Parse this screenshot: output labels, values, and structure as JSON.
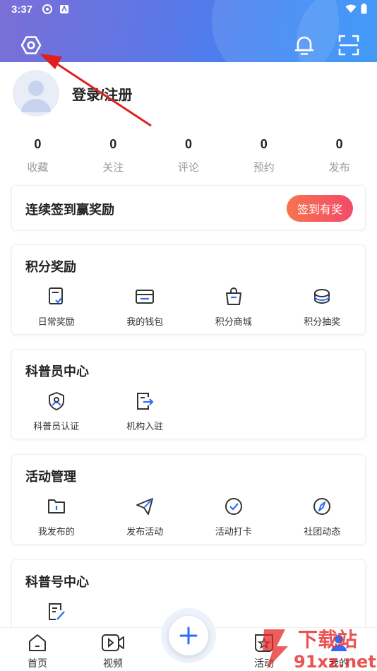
{
  "status_bar": {
    "time": "3:37"
  },
  "profile": {
    "login_label": "登录/注册"
  },
  "stats": [
    {
      "value": "0",
      "label": "收藏"
    },
    {
      "value": "0",
      "label": "关注"
    },
    {
      "value": "0",
      "label": "评论"
    },
    {
      "value": "0",
      "label": "预约"
    },
    {
      "value": "0",
      "label": "发布"
    }
  ],
  "signin_card": {
    "title": "连续签到赢奖励",
    "button_label": "签到有奖"
  },
  "points_card": {
    "title": "积分奖励",
    "items": [
      {
        "label": "日常奖励",
        "icon": "daily-reward-icon"
      },
      {
        "label": "我的钱包",
        "icon": "wallet-icon"
      },
      {
        "label": "积分商城",
        "icon": "shopping-bag-icon"
      },
      {
        "label": "积分抽奖",
        "icon": "coins-icon"
      }
    ]
  },
  "science_card": {
    "title": "科普员中心",
    "items": [
      {
        "label": "科普员认证",
        "icon": "shield-user-icon"
      },
      {
        "label": "机构入驻",
        "icon": "door-enter-icon"
      }
    ]
  },
  "activity_card": {
    "title": "活动管理",
    "items": [
      {
        "label": "我发布的",
        "icon": "folder-icon"
      },
      {
        "label": "发布活动",
        "icon": "paper-plane-icon"
      },
      {
        "label": "活动打卡",
        "icon": "check-circle-icon"
      },
      {
        "label": "社团动态",
        "icon": "compass-icon"
      }
    ]
  },
  "account_card": {
    "title": "科普号中心",
    "items": [
      {
        "icon": "edit-document-icon"
      }
    ]
  },
  "tabbar": {
    "tabs": [
      {
        "label": "首页",
        "icon": "home-icon"
      },
      {
        "label": "视频",
        "icon": "video-icon"
      },
      {
        "label": "活动",
        "icon": "activity-icon"
      },
      {
        "label": "我的",
        "icon": "user-icon"
      }
    ],
    "center_icon": "plus-icon"
  },
  "watermark": {
    "text_top": "下载站",
    "text_bottom": "91xz.net"
  },
  "colors": {
    "accent": "#2d6df6",
    "signin_start": "#f7734f",
    "signin_end": "#f24b6a",
    "arrow": "#e02020"
  }
}
